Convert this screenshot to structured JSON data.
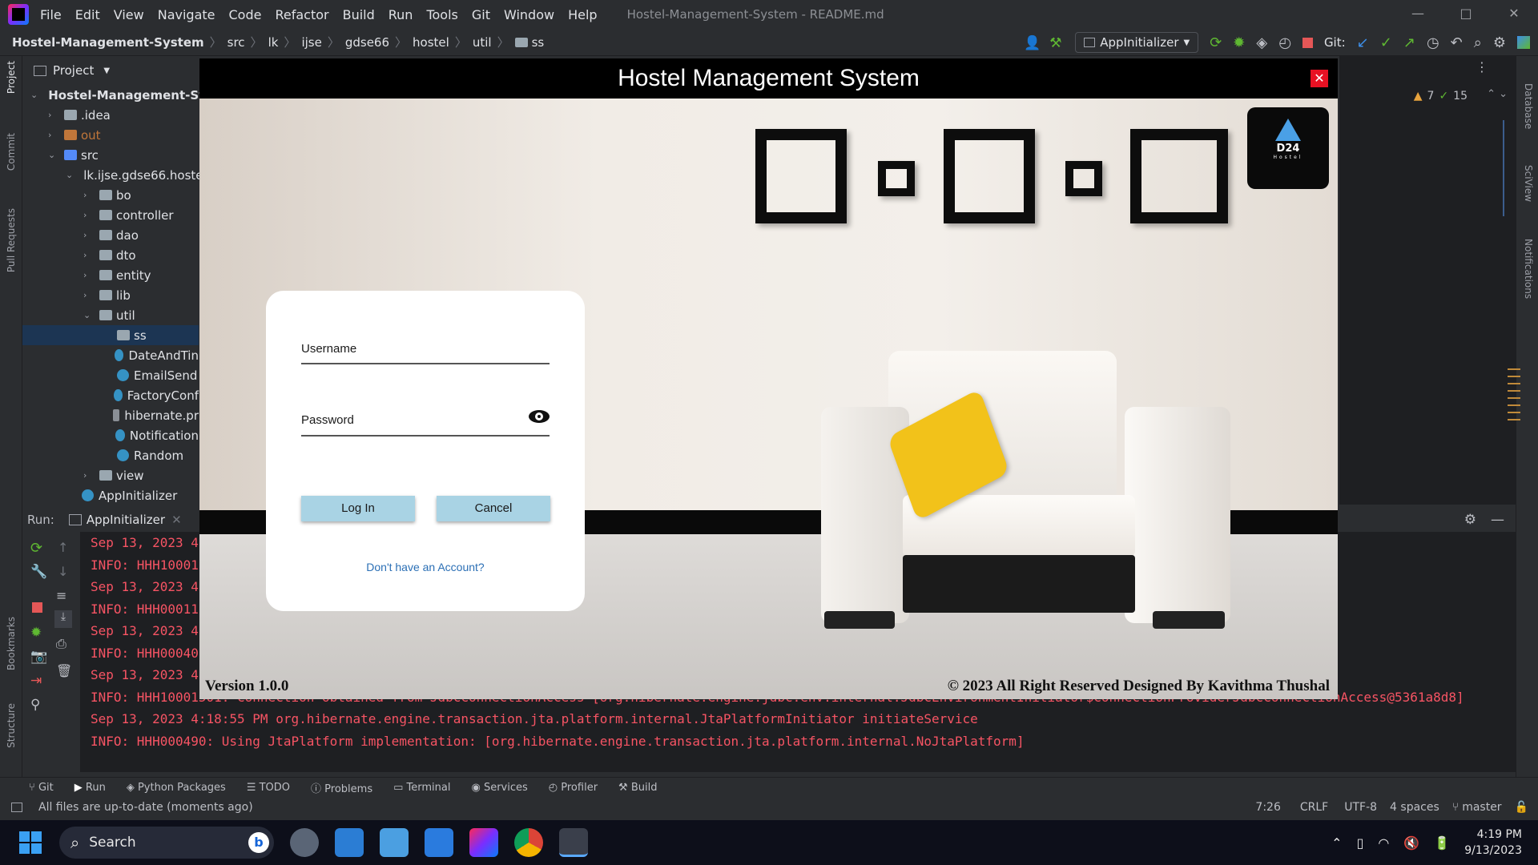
{
  "app": {
    "window_title": "Hostel-Management-System - README.md",
    "menu": [
      "File",
      "Edit",
      "View",
      "Navigate",
      "Code",
      "Refactor",
      "Build",
      "Run",
      "Tools",
      "Git",
      "Window",
      "Help"
    ],
    "window_controls": [
      "—",
      "□",
      "✕"
    ]
  },
  "breadcrumb": [
    "Hostel-Management-System",
    "src",
    "lk",
    "ijse",
    "gdse66",
    "hostel",
    "util",
    "ss"
  ],
  "toolbar": {
    "run_config": "AppInitializer",
    "git_label": "Git:"
  },
  "left_strip": [
    "Project",
    "Commit",
    "Pull Requests",
    "Bookmarks",
    "Structure"
  ],
  "right_strip": [
    "Database",
    "SciView",
    "Notifications"
  ],
  "project_panel": {
    "title": "Project",
    "tree": [
      {
        "label": "Hostel-Management-Sys",
        "indent": 0,
        "type": "module",
        "chev": "⌄"
      },
      {
        "label": ".idea",
        "indent": 1,
        "type": "folder",
        "chev": "›"
      },
      {
        "label": "out",
        "indent": 1,
        "type": "folder-orange",
        "chev": "›"
      },
      {
        "label": "src",
        "indent": 1,
        "type": "folder-blue",
        "chev": "⌄"
      },
      {
        "label": "lk.ijse.gdse66.hoste",
        "indent": 2,
        "type": "folder",
        "chev": "⌄"
      },
      {
        "label": "bo",
        "indent": 3,
        "type": "folder",
        "chev": "›"
      },
      {
        "label": "controller",
        "indent": 3,
        "type": "folder",
        "chev": "›"
      },
      {
        "label": "dao",
        "indent": 3,
        "type": "folder",
        "chev": "›"
      },
      {
        "label": "dto",
        "indent": 3,
        "type": "folder",
        "chev": "›"
      },
      {
        "label": "entity",
        "indent": 3,
        "type": "folder",
        "chev": "›"
      },
      {
        "label": "lib",
        "indent": 3,
        "type": "folder",
        "chev": "›"
      },
      {
        "label": "util",
        "indent": 3,
        "type": "folder",
        "chev": "⌄"
      },
      {
        "label": "ss",
        "indent": 4,
        "type": "folder",
        "chev": "",
        "selected": true
      },
      {
        "label": "DateAndTin",
        "indent": 4,
        "type": "class",
        "chev": ""
      },
      {
        "label": "EmailSend",
        "indent": 4,
        "type": "class",
        "chev": ""
      },
      {
        "label": "FactoryConf",
        "indent": 4,
        "type": "class",
        "chev": ""
      },
      {
        "label": "hibernate.pr",
        "indent": 4,
        "type": "file",
        "chev": ""
      },
      {
        "label": "Notification",
        "indent": 4,
        "type": "class",
        "chev": ""
      },
      {
        "label": "Random",
        "indent": 4,
        "type": "class",
        "chev": ""
      },
      {
        "label": "view",
        "indent": 3,
        "type": "folder",
        "chev": "›"
      },
      {
        "label": "AppInitializer",
        "indent": 2,
        "type": "class",
        "chev": ""
      }
    ]
  },
  "editor": {
    "warnings": "7",
    "checks": "15"
  },
  "run_panel": {
    "label": "Run:",
    "tab": "AppInitializer",
    "lines": [
      "Sep 13, 2023 4",
      "INFO: HHH10001",
      "Sep 13, 2023 4",
      "INFO: HHH00011",
      "Sep 13, 2023 4",
      "INFO: HHH00040",
      "Sep 13, 2023 4",
      "INFO: HHH10001501: Connection obtained from JdbcConnectionAccess [org.hibernate.engine.jdbc.env.internal.JdbcEnvironmentInitiator$ConnectionProviderJdbcConnectionAccess@5361a8d8]",
      "Sep 13, 2023 4:18:55 PM org.hibernate.engine.transaction.jta.platform.internal.JtaPlatformInitiator initiateService",
      "INFO: HHH000490: Using JtaPlatform implementation: [org.hibernate.engine.transaction.jta.platform.internal.NoJtaPlatform]"
    ]
  },
  "tool_tabs": [
    "Git",
    "Run",
    "Python Packages",
    "TODO",
    "Problems",
    "Terminal",
    "Services",
    "Profiler",
    "Build"
  ],
  "status_bar": {
    "message": "All files are up-to-date (moments ago)",
    "position": "7:26",
    "line_sep": "CRLF",
    "encoding": "UTF-8",
    "indent": "4 spaces",
    "branch": "master"
  },
  "taskbar": {
    "search": "Search",
    "time": "4:19 PM",
    "date": "9/13/2023"
  },
  "login_window": {
    "title": "Hostel Management System",
    "close": "✕",
    "badge_line1": "D24",
    "badge_line2": "Hostel",
    "username_label": "Username",
    "password_label": "Password",
    "login_button": "Log In",
    "cancel_button": "Cancel",
    "signup_link": "Don't have an Account?",
    "version": "Version 1.0.0",
    "copyright": "© 2023 All Right Reserved Designed By Kavithma Thushal"
  },
  "colors": {
    "ide_bg": "#2b2d30",
    "console_bg": "#1e1f22",
    "console_text": "#f75464",
    "button_bg": "#a9d3e4",
    "link": "#2b6fb5",
    "pillow": "#f2c21a"
  }
}
